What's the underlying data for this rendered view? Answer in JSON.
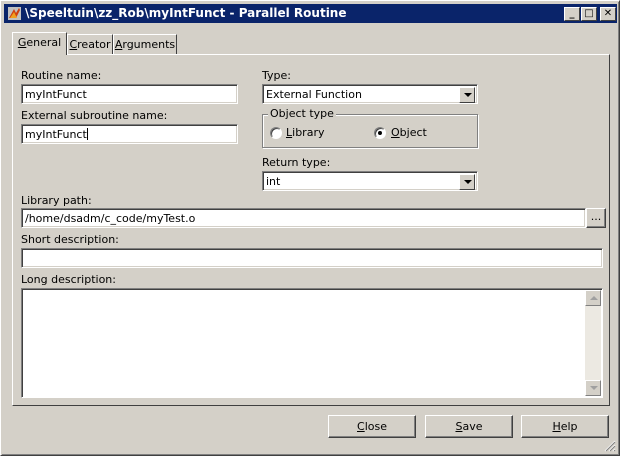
{
  "window": {
    "title": "\\Speeltuin\\zz_Rob\\myIntFunct - Parallel Routine",
    "minimize": "_",
    "maximize": "□",
    "close": "✕",
    "icon": "datastage-routine-icon"
  },
  "tabs": [
    {
      "label_pre": "",
      "label_key": "G",
      "label_post": "eneral",
      "active": true
    },
    {
      "label_pre": "",
      "label_key": "C",
      "label_post": "reator",
      "active": false
    },
    {
      "label_pre": "",
      "label_key": "A",
      "label_post": "rguments",
      "active": false
    }
  ],
  "form": {
    "routine_name_label": "Routine name:",
    "routine_name_value": "myIntFunct",
    "external_subroutine_label": "External subroutine name:",
    "external_subroutine_value": "myIntFunct",
    "type_label": "Type:",
    "type_value": "External Function",
    "object_type_label": "Object type",
    "library_option_key": "L",
    "library_option_rest": "ibrary",
    "object_option_key": "O",
    "object_option_rest": "bject",
    "selected_object_type": "Object",
    "return_type_label": "Return type:",
    "return_type_value": "int",
    "library_path_label": "Library path:",
    "library_path_value": "/home/dsadm/c_code/myTest.o",
    "browse_label": "...",
    "short_description_label": "Short description:",
    "short_description_value": "",
    "long_description_label": "Long description:",
    "long_description_value": ""
  },
  "buttons": {
    "close_key": "C",
    "close_rest": "lose",
    "save_key": "S",
    "save_rest": "ave",
    "help_key": "H",
    "help_rest": "elp"
  },
  "colors": {
    "title_bar": "#0a246a",
    "face": "#d4d0c8"
  }
}
